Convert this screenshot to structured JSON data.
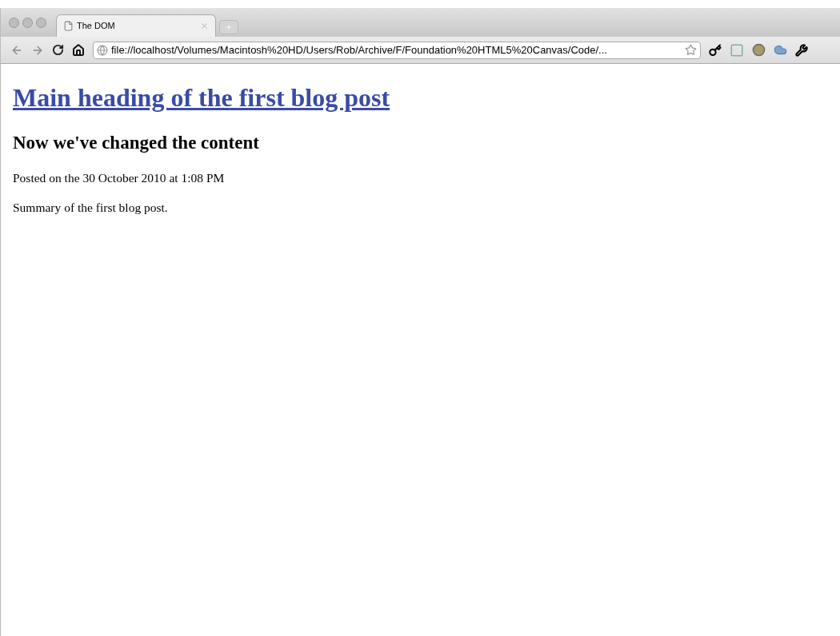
{
  "tabs": [
    {
      "title": "The DOM",
      "selected": true
    }
  ],
  "address_bar": {
    "url": "file://localhost/Volumes/Macintosh%20HD/Users/Rob/Archive/F/Foundation%20HTML5%20Canvas/Code/..."
  },
  "page": {
    "heading_link": "Main heading of the first blog post",
    "subheading": "Now we've changed the content",
    "posted": "Posted on the 30 October 2010 at 1:08 PM",
    "summary": "Summary of the first blog post."
  }
}
